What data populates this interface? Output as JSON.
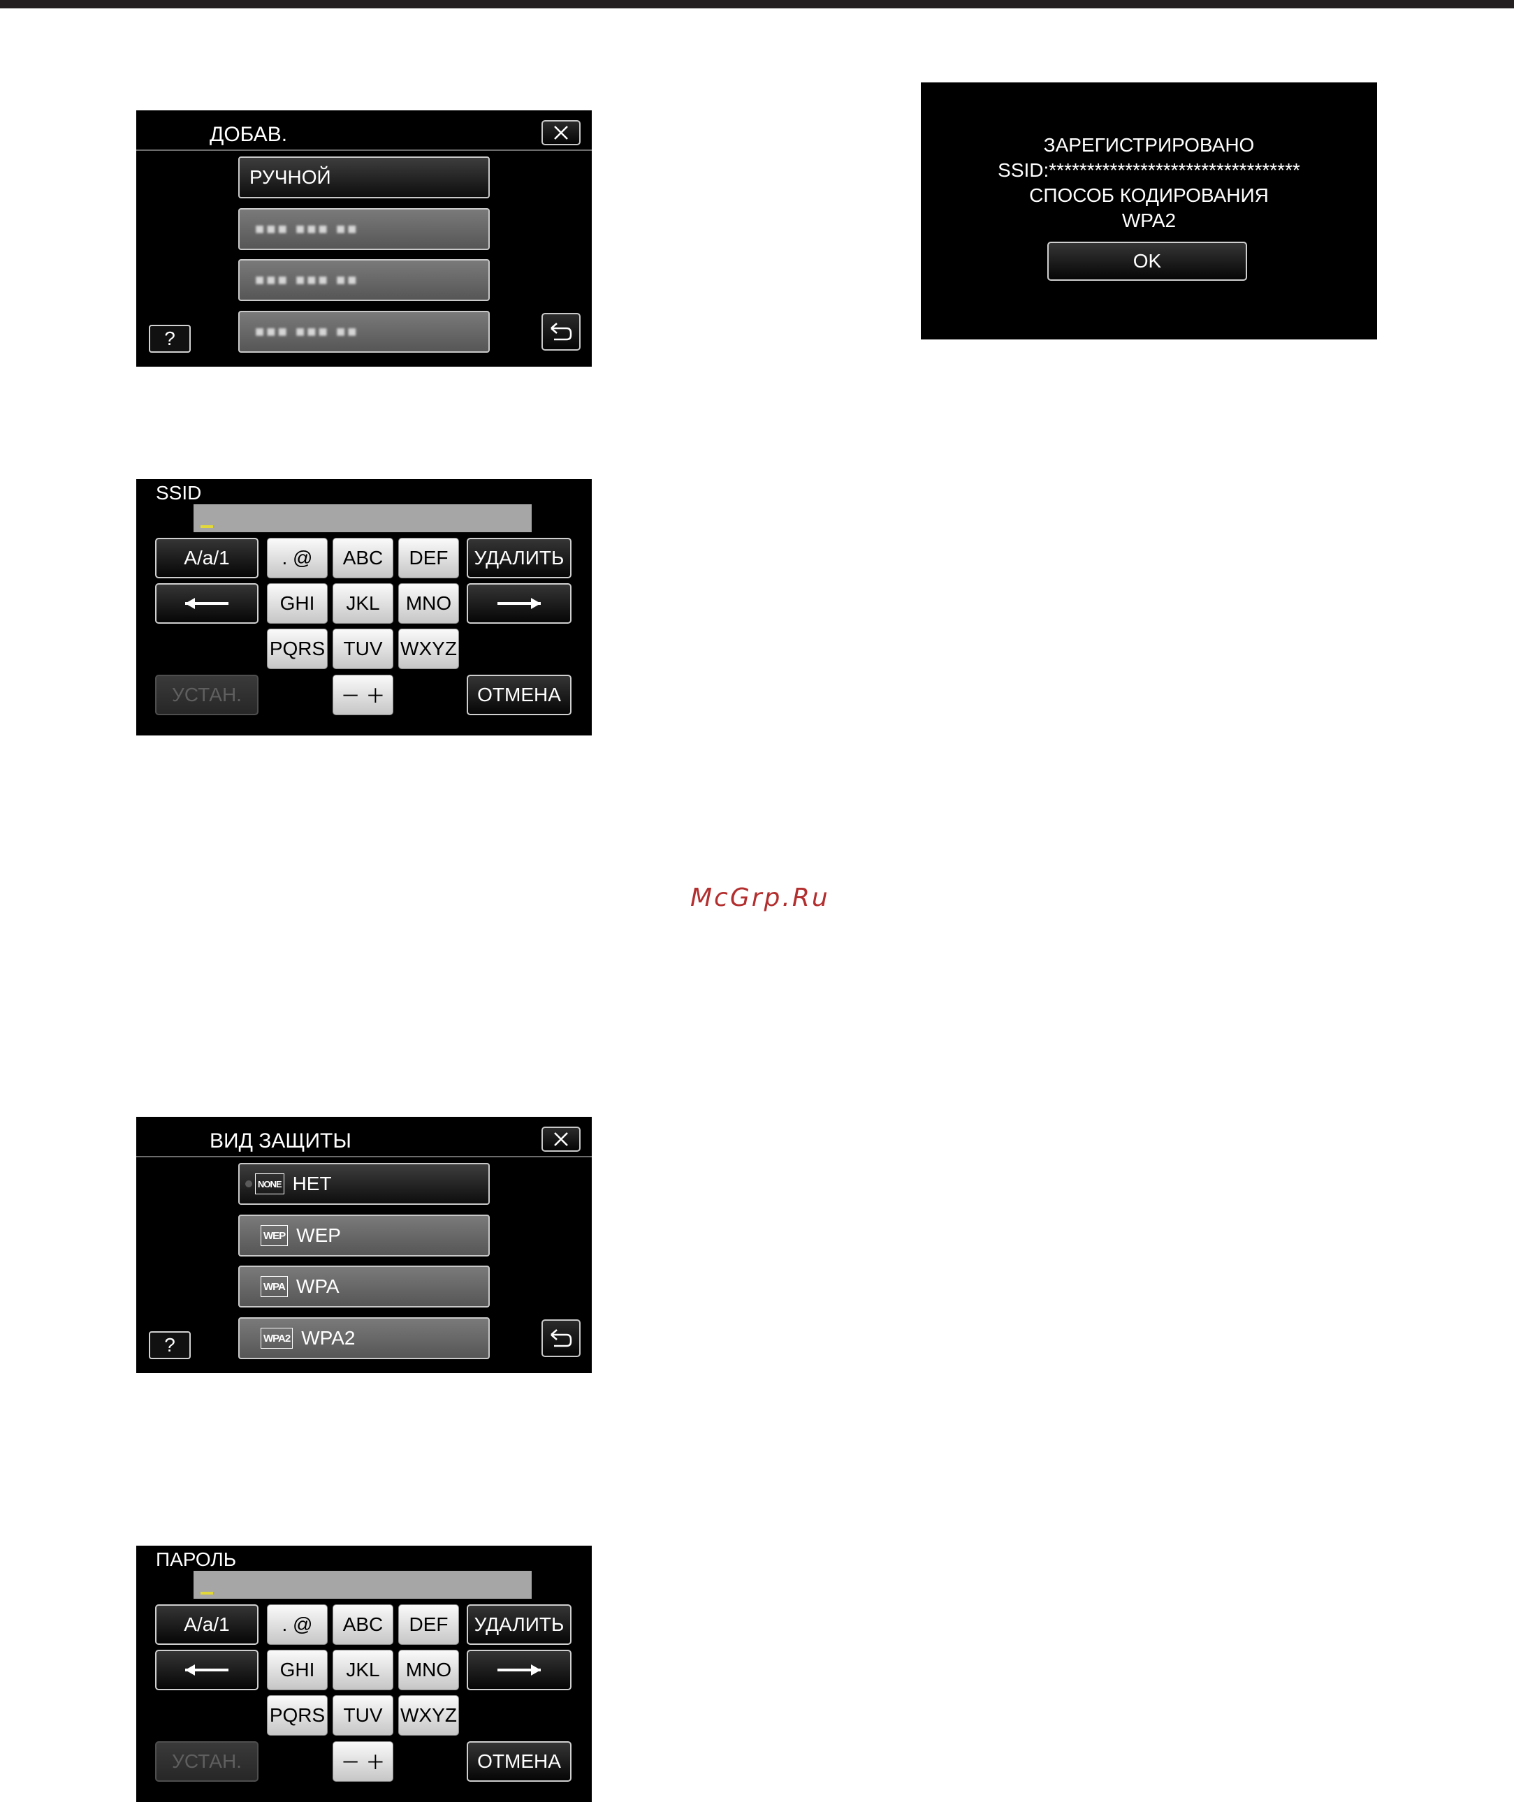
{
  "screens": {
    "add": {
      "title": "ДОБАВ.",
      "manual": "РУЧНОЙ",
      "blurred_items": [
        "■■■ ■■■ ■■",
        "■■■ ■■■ ■■",
        "■■■ ■■■ ■■"
      ],
      "help": "?"
    },
    "ssid": {
      "title": "SSID",
      "keys": {
        "mode": "A/a/1",
        "dot_at": ". @",
        "abc": "ABC",
        "def": "DEF",
        "delete": "УДАЛИТЬ",
        "ghi": "GHI",
        "jkl": "JKL",
        "mno": "MNO",
        "pqrs": "PQRS",
        "tuv": "TUV",
        "wxyz": "WXYZ",
        "set": "УСТАН.",
        "minus_plus": "－ ＋",
        "cancel": "ОТМЕНА"
      }
    },
    "security": {
      "title": "ВИД ЗАЩИТЫ",
      "options": [
        {
          "badge": "NONE",
          "label": "НЕТ"
        },
        {
          "badge": "WEP",
          "label": "WEP"
        },
        {
          "badge": "WPA",
          "label": "WPA"
        },
        {
          "badge": "WPA2",
          "label": "WPA2"
        }
      ],
      "help": "?"
    },
    "password": {
      "title": "ПАРОЛЬ",
      "keys": {
        "mode": "A/a/1",
        "dot_at": ". @",
        "abc": "ABC",
        "def": "DEF",
        "delete": "УДАЛИТЬ",
        "ghi": "GHI",
        "jkl": "JKL",
        "mno": "MNO",
        "pqrs": "PQRS",
        "tuv": "TUV",
        "wxyz": "WXYZ",
        "set": "УСТАН.",
        "minus_plus": "－ ＋",
        "cancel": "ОТМЕНА"
      }
    },
    "registered": {
      "line1": "ЗАРЕГИСТРИРОВАНО",
      "line2": "SSID:*********************************",
      "line3": "СПОСОБ КОДИРОВАНИЯ",
      "line4": "WPA2",
      "ok": "OK"
    }
  },
  "watermark": "McGrp.Ru",
  "colors": {
    "cursor": "#e2d838",
    "watermark": "#b32f2f"
  }
}
